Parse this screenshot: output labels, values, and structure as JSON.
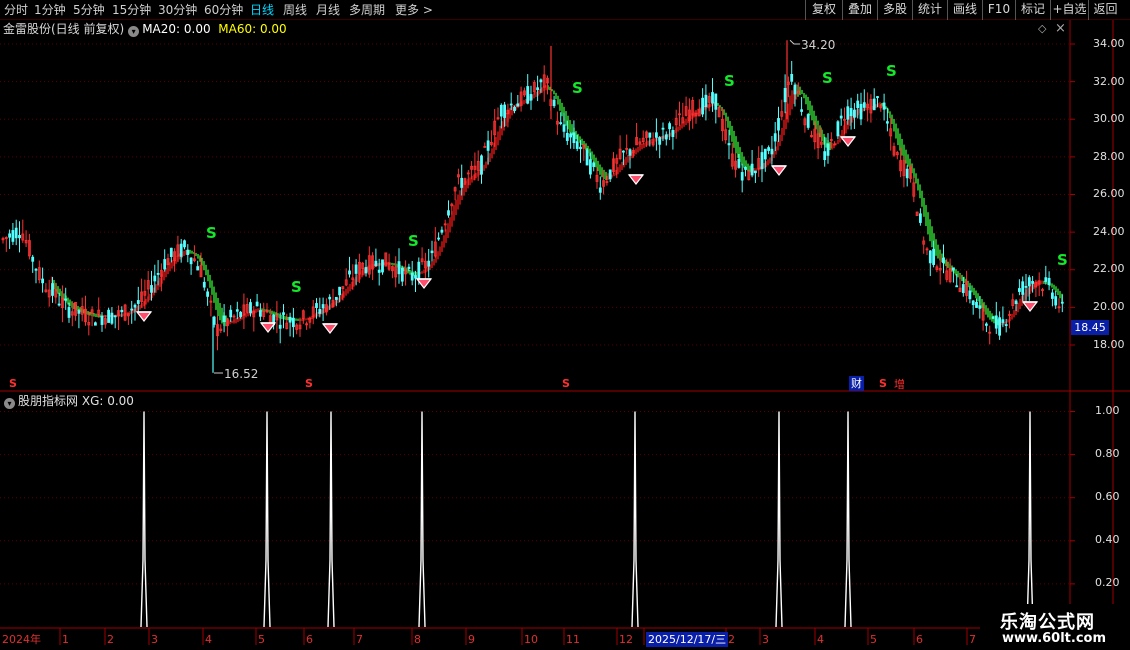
{
  "toolbar": {
    "periods": [
      "分时",
      "1分钟",
      "5分钟",
      "15分钟",
      "30分钟",
      "60分钟",
      "日线",
      "周线",
      "月线",
      "多周期",
      "更多 >"
    ],
    "active_period": "日线",
    "actions": [
      "复权",
      "叠加",
      "多股",
      "统计",
      "画线",
      "F10",
      "标记",
      "+自选",
      "返回"
    ]
  },
  "main_info": {
    "stock": "金雷股份(日线 前复权)",
    "ma20": "MA20: 0.00",
    "ma60": "MA60: 0.00",
    "ma20_color": "#ffffff",
    "ma60_color": "#ffff00"
  },
  "indicator_info": {
    "name": "股朋指标网",
    "value": "XG: 0.00"
  },
  "price_axis": [
    "34.00",
    "32.00",
    "30.00",
    "28.00",
    "26.00",
    "24.00",
    "22.00",
    "20.00",
    "18.00"
  ],
  "current_price": "18.45",
  "high_label": "34.20",
  "low_label": "16.52",
  "indicator_axis": [
    "1.00",
    "0.80",
    "0.60",
    "0.40",
    "0.20"
  ],
  "event_markers": [
    "财",
    "增"
  ],
  "signal_letter": "S",
  "date_axis": {
    "year": "2024年",
    "months": [
      "1",
      "2",
      "3",
      "4",
      "5",
      "6",
      "7",
      "8",
      "9",
      "10",
      "11",
      "12",
      "2",
      "3",
      "4",
      "5",
      "6",
      "7"
    ],
    "cursor": "2025/12/17/三"
  },
  "watermark": {
    "title": "乐淘公式网",
    "url": "www.60lt.com"
  },
  "colors": {
    "up": "#ff3232",
    "down": "#54ffff",
    "band_up": "#e01818",
    "band_down": "#33e033",
    "grid": "#5a0000",
    "axis": "#a00000"
  }
}
